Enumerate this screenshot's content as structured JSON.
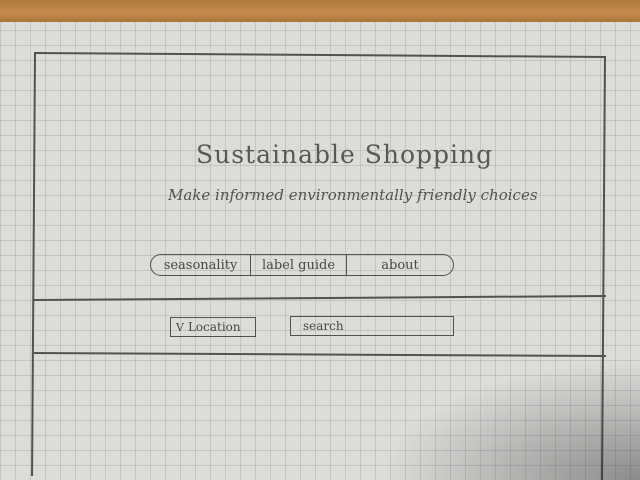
{
  "header": {
    "title": "Sustainable Shopping",
    "subtitle": "Make informed environmentally friendly choices"
  },
  "nav": {
    "items": [
      {
        "label": "seasonality"
      },
      {
        "label": "label guide"
      },
      {
        "label": "about"
      }
    ]
  },
  "filters": {
    "location": {
      "chevron": "V",
      "label": "Location"
    },
    "search": {
      "placeholder": "search"
    }
  }
}
